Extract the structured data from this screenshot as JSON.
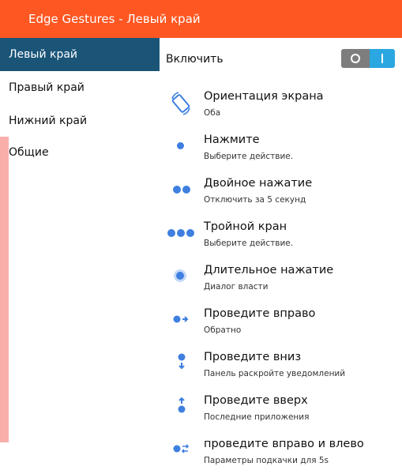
{
  "window": {
    "title": "Edge Gestures - Левый край"
  },
  "colors": {
    "titlebar": "#fe5722",
    "sidebar_active": "#1a5578",
    "accent": "#3e7fe0",
    "strip": "#f9aeaa",
    "toggle_on": "#2aa7e0"
  },
  "sidebar": {
    "items": [
      {
        "label": "Левый край",
        "active": true
      },
      {
        "label": "Правый край",
        "active": false
      },
      {
        "label": "Нижний край",
        "active": false
      },
      {
        "label": "Общие",
        "active": false
      }
    ]
  },
  "main": {
    "enable": {
      "label": "Включить",
      "state": "on"
    },
    "settings": [
      {
        "title": "Ориентация экрана",
        "value": "Оба",
        "icon": "screen-rotation-icon"
      },
      {
        "title": "Нажмите",
        "value": "Выберите действие.",
        "icon": "single-dot-icon"
      },
      {
        "title": "Двойное нажатие",
        "value": "Отключить за 5 секунд",
        "icon": "double-dot-icon"
      },
      {
        "title": "Тройной кран",
        "value": "Выберите действие.",
        "icon": "triple-dot-icon"
      },
      {
        "title": "Длительное нажатие",
        "value": "Диалог власти",
        "icon": "long-press-icon"
      },
      {
        "title": "Проведите вправо",
        "value": "Обратно",
        "icon": "swipe-right-icon"
      },
      {
        "title": "Проведите вниз",
        "value": "Панель раскройте уведомлений",
        "icon": "swipe-down-icon"
      },
      {
        "title": "Проведите вверх",
        "value": "Последние приложения",
        "icon": "swipe-up-icon"
      },
      {
        "title": "проведите вправо и влево",
        "value": "Параметры подкачки для 5s",
        "icon": "swipe-right-left-icon"
      }
    ]
  }
}
